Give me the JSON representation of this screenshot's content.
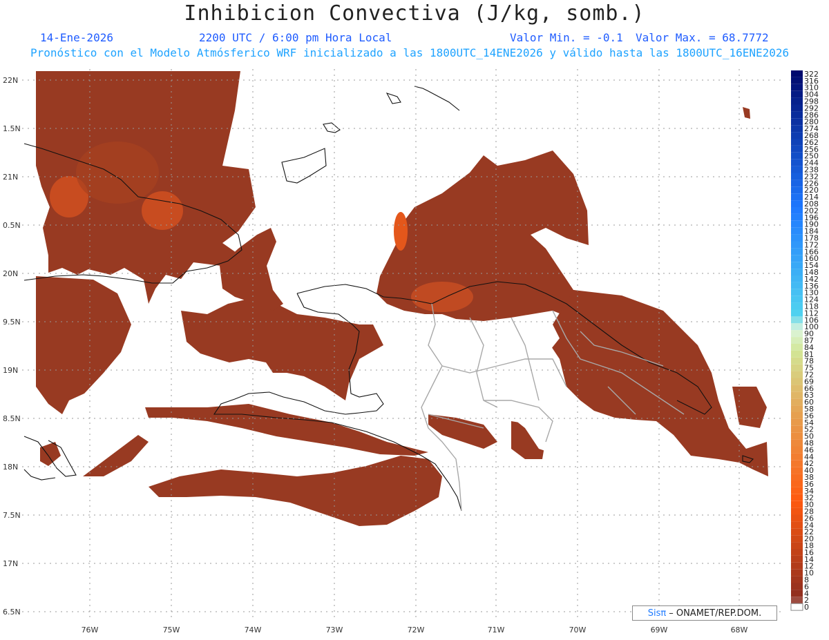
{
  "header": {
    "title": "Inhibicion Convectiva (J/kg, somb.)",
    "date": "14-Ene-2026",
    "time": "2200 UTC / 6:00 pm Hora Local",
    "valmin": "Valor Min. = -0.1",
    "valmax": "Valor Max. = 68.7772",
    "info": "Pronóstico con el Modelo Atmósferico WRF inicializado a las 1800UTC_14ENE2026 y válido hasta las  1800UTC_16ENE2026"
  },
  "axes": {
    "lat_labels": [
      "22N",
      "1.5N",
      "21N",
      "0.5N",
      "20N",
      "9.5N",
      "19N",
      "8.5N",
      "18N",
      "7.5N",
      "17N",
      "6.5N"
    ],
    "lon_labels": [
      "76W",
      "75W",
      "74W",
      "73W",
      "72W",
      "71W",
      "70W",
      "69W",
      "68W"
    ]
  },
  "colorbar": {
    "labels": [
      "322",
      "316",
      "310",
      "304",
      "298",
      "292",
      "286",
      "280",
      "274",
      "268",
      "262",
      "256",
      "250",
      "244",
      "238",
      "232",
      "226",
      "220",
      "214",
      "208",
      "202",
      "196",
      "190",
      "184",
      "178",
      "172",
      "166",
      "160",
      "154",
      "148",
      "142",
      "136",
      "130",
      "124",
      "118",
      "112",
      "106",
      "100",
      "90",
      "87",
      "84",
      "81",
      "78",
      "75",
      "72",
      "69",
      "66",
      "63",
      "60",
      "58",
      "56",
      "54",
      "52",
      "50",
      "48",
      "46",
      "44",
      "42",
      "40",
      "38",
      "36",
      "34",
      "32",
      "30",
      "28",
      "26",
      "24",
      "22",
      "20",
      "18",
      "16",
      "14",
      "12",
      "10",
      "8",
      "6",
      "4",
      "2",
      "0"
    ],
    "colors": {
      "top": "#000a6e",
      "blue_mid": "#1e78ff",
      "cyan": "#50d2f0",
      "pale": "#dcf5dc",
      "green_tan": "#d2e696",
      "tan": "#e6a050",
      "orange": "#ff5a10",
      "brown": "#8c2d20",
      "zero": "#ffffff"
    }
  },
  "footer": {
    "sis": "Sisπ",
    "org": "– ONAMET/REP.DOM."
  },
  "field_colors": {
    "base": "#983a22",
    "mid": "#b04523",
    "hot": "#e4571b",
    "coast": "#111111",
    "border": "#a8a8a8"
  }
}
